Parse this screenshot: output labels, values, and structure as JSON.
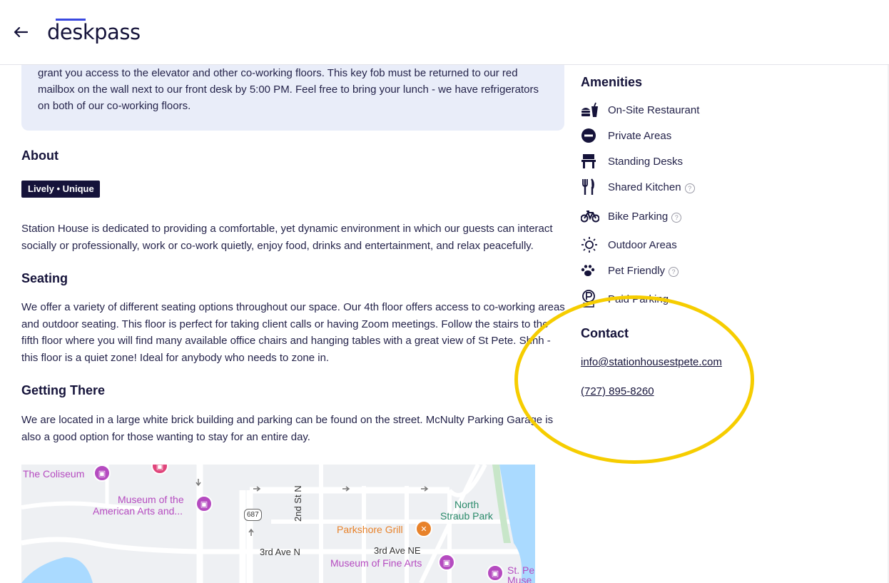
{
  "header": {
    "logo_text": "deskpass"
  },
  "main": {
    "info_lines": [
      "grant you access to the elevator and other co-working floors. This key fob must be returned to our red",
      "mailbox on the wall next to our front desk by 5:00 PM.  Feel free to bring your lunch - we have refrigerators",
      "on both of our co-working floors."
    ],
    "about": {
      "title": "About",
      "tag": "Lively • Unique",
      "text": "Station House is dedicated to providing a comfortable, yet dynamic environment in which our guests can interact socially or professionally, work or co-work quietly, enjoy food, drinks and entertainment, and relax peacefully."
    },
    "seating": {
      "title": "Seating",
      "text": "We offer a variety of different seating options throughout our space. Our 4th floor offers access to co-working areas and outdoor seating. This floor is perfect for taking client calls or having Zoom meetings. Follow the stairs to the fifth floor where you will find many available office chairs and hanging tables with a great view of St Pete. Shhh - this floor is a quiet zone! Ideal for anybody who needs to zone in."
    },
    "getting_there": {
      "title": "Getting There",
      "text": "We are located in a large white brick building and parking can be found on the street. McNulty Parking Garage is also a good option for those wanting to stay for an entire day."
    },
    "map": {
      "labels": {
        "coliseum": "The Coliseum",
        "museum_american_1": "Museum of the",
        "museum_american_2": "American Arts and...",
        "route": "687",
        "street_2nd": "2nd St N",
        "north_straub_1": "North",
        "north_straub_2": "Straub Park",
        "parkshore": "Parkshore Grill",
        "third_ave_n": "3rd Ave N",
        "third_ave_ne": "3rd Ave NE",
        "fine_arts": "Museum of Fine Arts",
        "st_pete_1": "St. Pe",
        "st_pete_2": "Muse"
      },
      "colors": {
        "attraction": "#b54bc0",
        "restaurant": "#e8822a",
        "water": "#aadaff",
        "road": "#ffffff"
      }
    }
  },
  "sidebar": {
    "amenities_title": "Amenities",
    "amenities": [
      {
        "label": "On-Site Restaurant",
        "icon": "restaurant-icon",
        "help": false
      },
      {
        "label": "Private Areas",
        "icon": "private-area-icon",
        "help": false
      },
      {
        "label": "Standing Desks",
        "icon": "standing-desk-icon",
        "help": false
      },
      {
        "label": "Shared Kitchen",
        "icon": "utensils-icon",
        "help": true
      },
      {
        "label": "Bike Parking",
        "icon": "bicycle-icon",
        "help": true
      },
      {
        "label": "Outdoor Areas",
        "icon": "sun-icon",
        "help": false
      },
      {
        "label": "Pet Friendly",
        "icon": "paw-icon",
        "help": true
      },
      {
        "label": "Paid Parking",
        "icon": "parking-icon",
        "help": false
      }
    ],
    "help_glyph": "?",
    "contact_title": "Contact",
    "email": "info@stationhousestpete.com",
    "phone": "(727) 895-8260"
  },
  "colors": {
    "navy": "#15133a",
    "accent": "#3a49e0",
    "info_bg": "#e9edf9",
    "annotation": "#f6cd00"
  }
}
